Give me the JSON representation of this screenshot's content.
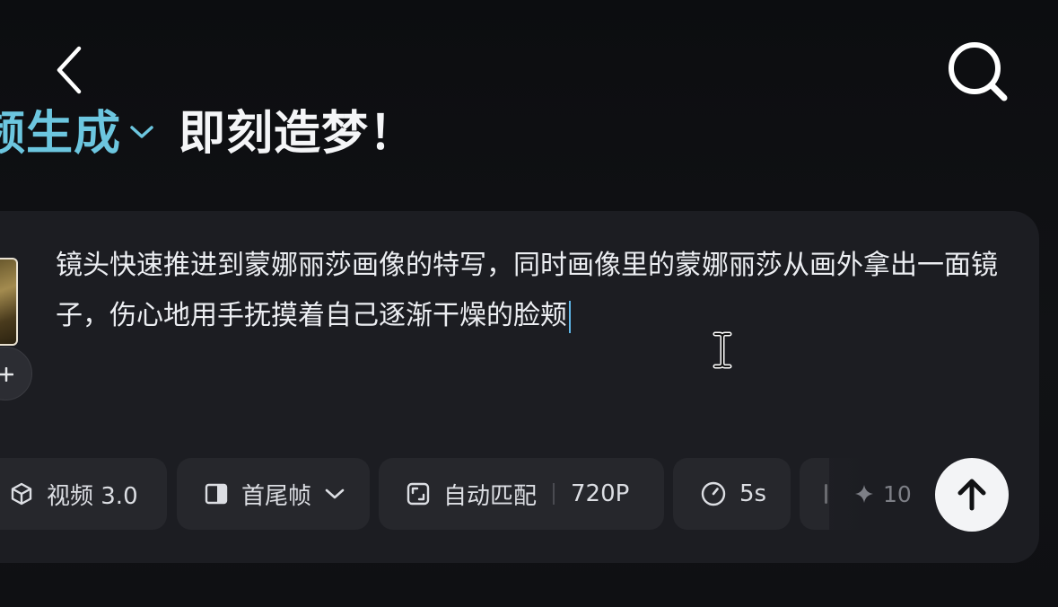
{
  "header": {
    "back_icon": "chevron-left-icon",
    "search_icon": "search-icon",
    "mode_label": "频生成",
    "mode_chevron_icon": "chevron-down-icon",
    "slogan": "即刻造梦！"
  },
  "composer": {
    "prompt_text": "镜头快速推进到蒙娜丽莎画像的特写，同时画像里的蒙娜丽莎从画外拿出一面镜子，伤心地用手抚摸着自己逐渐干燥的脸颊",
    "add_reference_icon": "plus-icon",
    "cursor_icon": "text-cursor-icon"
  },
  "toolbar": {
    "model": {
      "icon": "cube-icon",
      "label": "视频 3.0"
    },
    "frames": {
      "icon": "frame-icon",
      "label": "首尾帧",
      "chevron_icon": "chevron-down-icon"
    },
    "ratio": {
      "icon": "aspect-ratio-icon",
      "label": "自动匹配",
      "resolution": "720P"
    },
    "duration": {
      "icon": "clock-icon",
      "label": "5s"
    },
    "credits": {
      "icon": "sparkle-icon",
      "value": "10"
    },
    "submit_icon": "arrow-up-icon"
  },
  "colors": {
    "background": "#0d0e11",
    "panel": "#1c1d22",
    "chip": "#26272c",
    "accent": "#6cc6df",
    "caret": "#5eb6e8",
    "submit": "#f3f4f6"
  }
}
